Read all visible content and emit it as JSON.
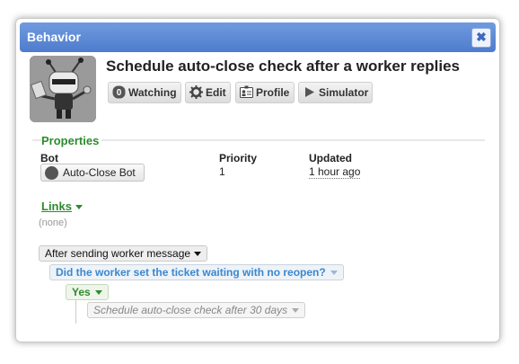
{
  "dialog": {
    "title": "Behavior",
    "close_symbol": "✖"
  },
  "header": {
    "title": "Schedule auto-close check after a worker replies",
    "buttons": {
      "watching": {
        "count": "0",
        "label": "Watching"
      },
      "edit": "Edit",
      "profile": "Profile",
      "simulator": "Simulator"
    }
  },
  "properties": {
    "title": "Properties",
    "columns": {
      "bot": {
        "label": "Bot",
        "value": "Auto-Close Bot"
      },
      "priority": {
        "label": "Priority",
        "value": "1"
      },
      "updated": {
        "label": "Updated",
        "value": "1 hour ago"
      }
    }
  },
  "links": {
    "title": "Links",
    "empty": "(none)"
  },
  "decision_tree": {
    "trigger": "After sending worker message",
    "condition": "Did the worker set the ticket waiting with no reopen?",
    "outcome": "Yes",
    "action": "Schedule auto-close check after 30 days"
  },
  "colors": {
    "titlebar": "#4f7ccc",
    "section_green": "#2d8b2d",
    "condition_blue": "#3a87d0"
  }
}
